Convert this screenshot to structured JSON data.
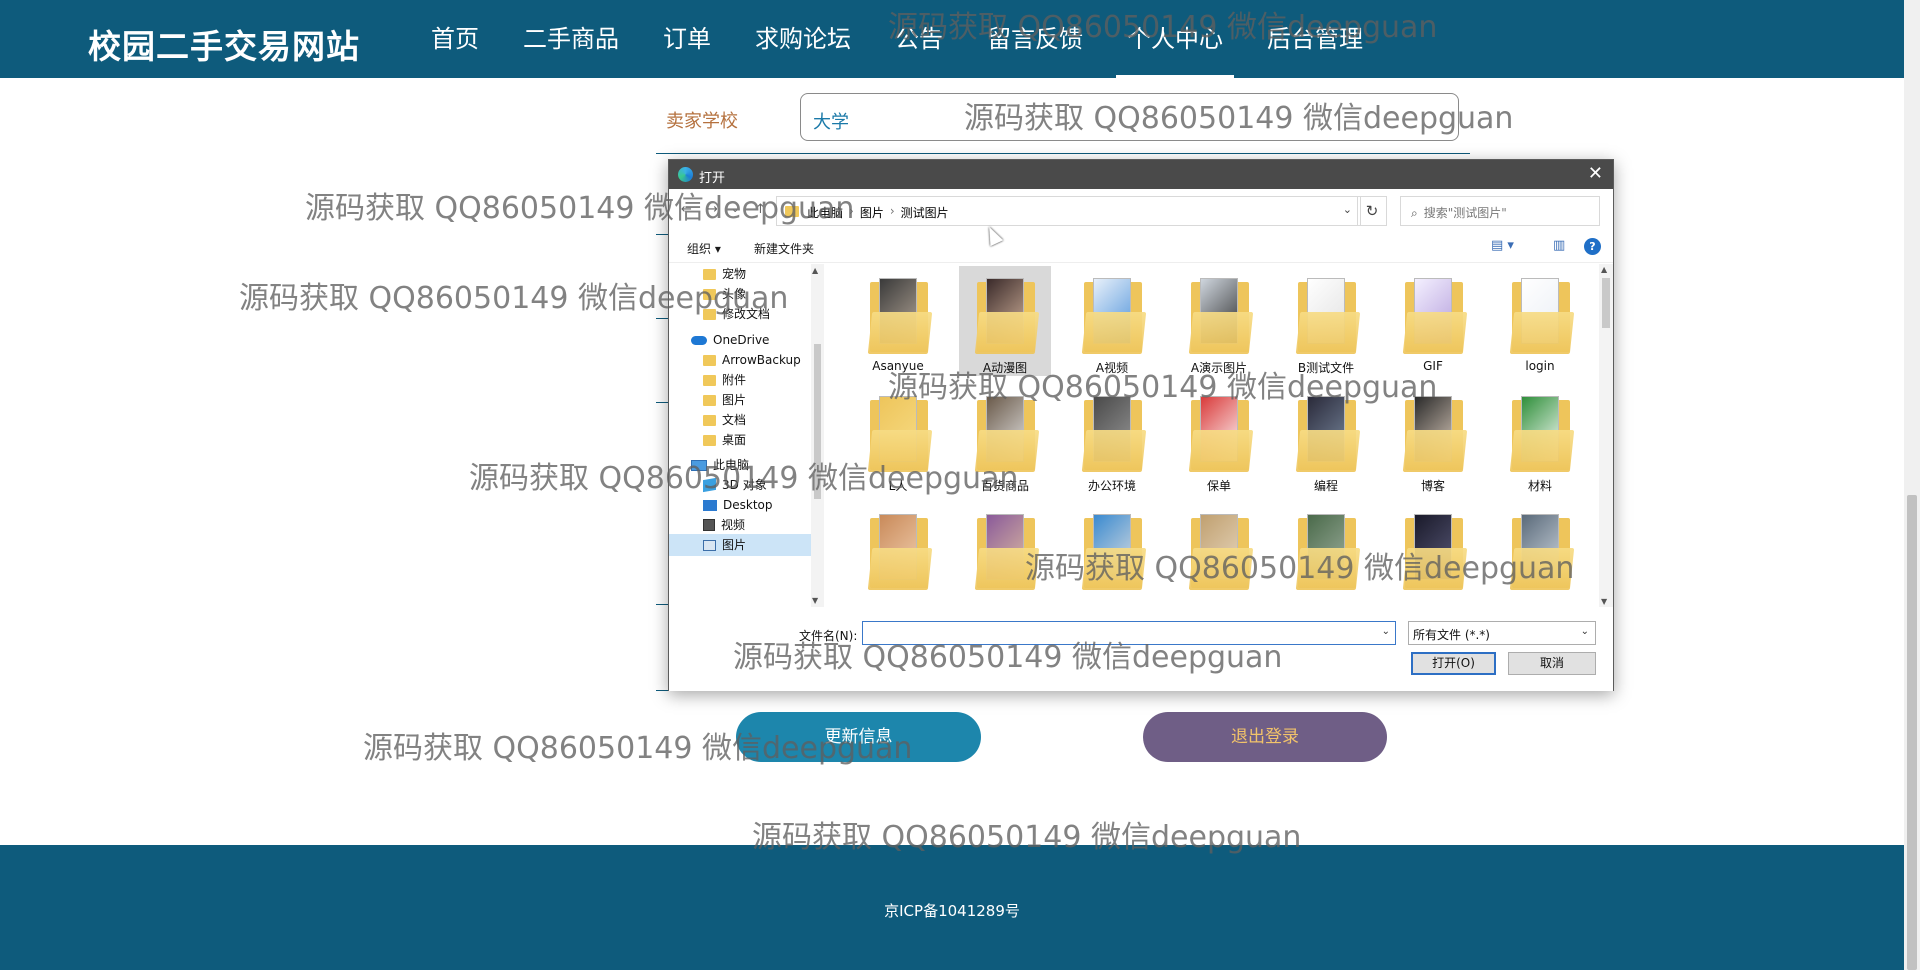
{
  "site": {
    "brand": "校园二手交易网站",
    "nav": [
      "首页",
      "二手商品",
      "订单",
      "求购论坛",
      "公告",
      "留言反馈",
      "个人中心",
      "后台管理"
    ],
    "active_nav": "个人中心"
  },
  "form": {
    "seller_school_label": "卖家学校",
    "seller_school_value": "大学",
    "update_button": "更新信息",
    "logout_button": "退出登录"
  },
  "footer": {
    "icp": "京ICP备1041289号"
  },
  "dialog": {
    "title": "打开",
    "breadcrumbs": [
      "此电脑",
      "图片",
      "测试图片"
    ],
    "search_placeholder": "搜索\"测试图片\"",
    "toolbar": {
      "organize": "组织 ▾",
      "new_folder": "新建文件夹"
    },
    "tree": [
      "宠物",
      "头像",
      "修改文档",
      "OneDrive",
      "ArrowBackup",
      "附件",
      "图片",
      "文档",
      "桌面",
      "此电脑",
      "3D 对象",
      "Desktop",
      "视频",
      "图片"
    ],
    "tiles": [
      "Asanyue",
      "A动漫图",
      "A视频",
      "A演示图片",
      "B测试文件",
      "GIF",
      "login",
      "L人",
      "百货商品",
      "办公环境",
      "保单",
      "编程",
      "博客",
      "材料",
      "",
      "",
      "",
      "",
      "",
      "",
      ""
    ],
    "filename_label": "文件名(N):",
    "filename_value": "",
    "filetype": "所有文件 (*.*)",
    "open_button": "打开(O)",
    "cancel_button": "取消",
    "close_glyph": "✕"
  },
  "watermark": "源码获取 QQ86050149 微信deepguan",
  "colors": {
    "header": "#0e5b7c",
    "update_btn": "#1d86ac",
    "logout_btn": "#6f5e86",
    "logout_text": "#f2c36a",
    "label": "#b5713e"
  }
}
